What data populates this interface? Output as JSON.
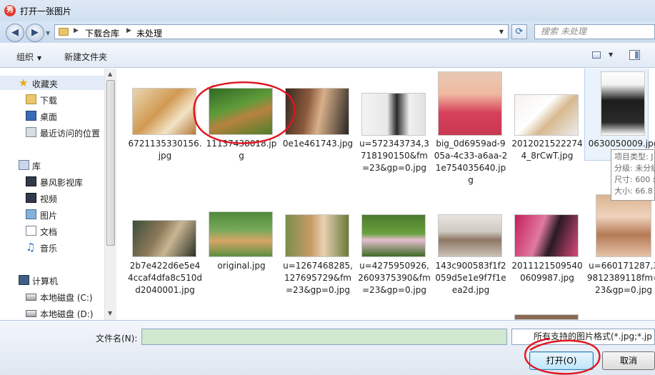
{
  "window": {
    "title": "打开一张图片",
    "app_icon_text": "秀"
  },
  "address": {
    "crumbs": [
      "下载合库",
      "未处理"
    ],
    "search_placeholder": "搜索 未处理"
  },
  "toolbar": {
    "organize_label": "组织",
    "new_folder_label": "新建文件夹"
  },
  "nav": {
    "items": [
      {
        "label": "收藏夹",
        "icon": "star-icon"
      },
      {
        "label": "下载",
        "icon": "folder-icon"
      },
      {
        "label": "桌面",
        "icon": "desktop-icon"
      },
      {
        "label": "最近访问的位置",
        "icon": "recent-places-icon"
      },
      {
        "label": "库",
        "icon": "library-icon"
      },
      {
        "label": "暴风影视库",
        "icon": "video-library-icon"
      },
      {
        "label": "视频",
        "icon": "video-icon"
      },
      {
        "label": "图片",
        "icon": "pictures-icon"
      },
      {
        "label": "文档",
        "icon": "documents-icon"
      },
      {
        "label": "音乐",
        "icon": "music-icon"
      },
      {
        "label": "计算机",
        "icon": "computer-icon"
      },
      {
        "label": "本地磁盘 (C:)",
        "icon": "drive-icon"
      },
      {
        "label": "本地磁盘 (D:)",
        "icon": "drive-icon"
      }
    ]
  },
  "files": [
    {
      "name": "6721135330156.jpg"
    },
    {
      "name": "11137438018.jpg"
    },
    {
      "name": "0e1e461743.jpg"
    },
    {
      "name": "u=572343734,3718190150&fm=23&gp=0.jpg"
    },
    {
      "name": "big_0d6959ad-905a-4c33-a6aa-21e754035640.jpg"
    },
    {
      "name": "20120215222744_8rCwT.jpg"
    },
    {
      "name": "0630050009.jpg"
    },
    {
      "name": "2b7e422d6e5e44ccaf4dfa8c510dd2040001.jpg"
    },
    {
      "name": "original.jpg"
    },
    {
      "name": "u=1267468285,127695729&fm=23&gp=0.jpg"
    },
    {
      "name": "u=4275950926,2609375390&fm=23&gp=0.jpg"
    },
    {
      "name": "143c900583f1f2059d5e1e9f7f1eea2d.jpg"
    },
    {
      "name": "20111215095400609987.jpg"
    },
    {
      "name": "u=660171287,39812389118fm=23&gp=0.jpg"
    }
  ],
  "tooltip": {
    "lines": [
      "项目类型: J",
      "分级: 未分级",
      "尺寸: 600 x",
      "大小: 66.8"
    ]
  },
  "bottom": {
    "filename_label": "文件名(N):",
    "filename_value": "",
    "filter_text": "所有支持的图片格式(*.jpg;*.jp",
    "open_label": "打开(O)",
    "cancel_label": "取消"
  },
  "colors": {
    "annotation_red": "#e0141e",
    "accent": "#3c7fb1"
  }
}
